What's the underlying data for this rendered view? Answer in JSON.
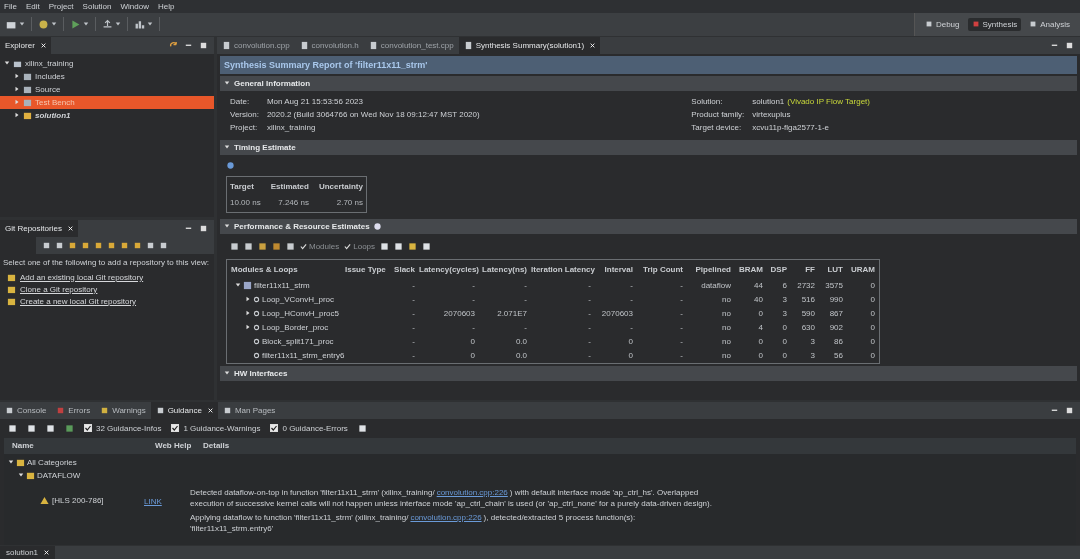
{
  "menu": [
    "File",
    "Edit",
    "Project",
    "Solution",
    "Window",
    "Help"
  ],
  "perspectives": [
    {
      "label": "Debug",
      "selected": false
    },
    {
      "label": "Synthesis",
      "selected": true
    },
    {
      "label": "Analysis",
      "selected": false
    }
  ],
  "explorer": {
    "title": "Explorer",
    "tree": [
      {
        "label": "xilinx_training",
        "expanded": true,
        "selected": false,
        "active": false,
        "children": [
          {
            "label": "Includes",
            "expanded": false,
            "selected": false,
            "active": false
          },
          {
            "label": "Source",
            "expanded": false,
            "selected": false,
            "active": false
          },
          {
            "label": "Test Bench",
            "expanded": false,
            "selected": true,
            "active": false
          },
          {
            "label": "solution1",
            "expanded": false,
            "selected": false,
            "active": true
          }
        ]
      }
    ]
  },
  "git": {
    "title": "Git Repositories",
    "intro": "Select one of the following to add a repository to this view:",
    "links": [
      "Add an existing local Git repository",
      "Clone a Git repository",
      "Create a new local Git repository"
    ]
  },
  "editor_tabs": [
    {
      "label": "convolution.cpp",
      "selected": false
    },
    {
      "label": "convolution.h",
      "selected": false
    },
    {
      "label": "convolution_test.cpp",
      "selected": false
    },
    {
      "label": "Synthesis Summary(solution1)",
      "selected": true
    }
  ],
  "report": {
    "title": "Synthesis Summary Report of 'filter11x11_strm'",
    "general": {
      "heading": "General Information",
      "left": [
        {
          "label": "Date:",
          "value": "Mon Aug 21 15:53:56 2023"
        },
        {
          "label": "Version:",
          "value": "2020.2 (Build 3064766 on Wed Nov 18 09:12:47 MST 2020)"
        },
        {
          "label": "Project:",
          "value": "xilinx_training"
        }
      ],
      "right": [
        {
          "label": "Solution:",
          "value": "solution1",
          "note": "(Vivado IP Flow Target)"
        },
        {
          "label": "Product family:",
          "value": "virtexuplus"
        },
        {
          "label": "Target device:",
          "value": "xcvu11p-flga2577-1-e"
        }
      ]
    },
    "timing": {
      "heading": "Timing Estimate",
      "columns": [
        "Target",
        "Estimated",
        "Uncertainty"
      ],
      "values": [
        "10.00 ns",
        "7.246 ns",
        "2.70 ns"
      ]
    },
    "perf": {
      "heading": "Performance & Resource Estimates",
      "filters": [
        {
          "label": "Modules",
          "checked": true
        },
        {
          "label": "Loops",
          "checked": true
        }
      ],
      "columns": [
        "Modules & Loops",
        "Issue Type",
        "Slack",
        "Latency(cycles)",
        "Latency(ns)",
        "Iteration Latency",
        "Interval",
        "Trip Count",
        "Pipelined",
        "BRAM",
        "DSP",
        "FF",
        "LUT",
        "URAM"
      ],
      "rows": [
        {
          "kind": "module",
          "expanded": true,
          "cells": [
            "filter11x11_strm",
            "",
            "-",
            "-",
            "-",
            "-",
            "-",
            "-",
            "dataflow",
            "44",
            "6",
            "2732",
            "3575",
            "0"
          ],
          "children": [
            {
              "kind": "group",
              "expanded": false,
              "cells": [
                "Loop_VConvH_proc",
                "",
                "-",
                "-",
                "-",
                "-",
                "-",
                "-",
                "no",
                "40",
                "3",
                "516",
                "990",
                "0"
              ]
            },
            {
              "kind": "group",
              "expanded": false,
              "cells": [
                "Loop_HConvH_proc5",
                "",
                "-",
                "2070603",
                "2.071E7",
                "-",
                "2070603",
                "-",
                "no",
                "0",
                "3",
                "590",
                "867",
                "0"
              ]
            },
            {
              "kind": "group",
              "expanded": false,
              "cells": [
                "Loop_Border_proc",
                "",
                "-",
                "-",
                "-",
                "-",
                "-",
                "-",
                "no",
                "4",
                "0",
                "630",
                "902",
                "0"
              ]
            },
            {
              "kind": "leaf",
              "cells": [
                "Block_split171_proc",
                "",
                "-",
                "0",
                "0.0",
                "-",
                "0",
                "-",
                "no",
                "0",
                "0",
                "3",
                "86",
                "0"
              ]
            },
            {
              "kind": "leaf",
              "cells": [
                "filter11x11_strm_entry6",
                "",
                "-",
                "0",
                "0.0",
                "-",
                "0",
                "-",
                "no",
                "0",
                "0",
                "3",
                "56",
                "0"
              ]
            }
          ]
        }
      ]
    },
    "hw": {
      "heading": "HW Interfaces"
    }
  },
  "bottom_tabs": [
    {
      "label": "Console",
      "selected": false
    },
    {
      "label": "Errors",
      "selected": false
    },
    {
      "label": "Warnings",
      "selected": false
    },
    {
      "label": "Guidance",
      "selected": true
    },
    {
      "label": "Man Pages",
      "selected": false
    }
  ],
  "guidance": {
    "filters": [
      {
        "label": "32 Guidance-Infos",
        "checked": true
      },
      {
        "label": "1 Guidance-Warnings",
        "checked": true
      },
      {
        "label": "0 Guidance-Errors",
        "checked": true
      }
    ],
    "columns": [
      "Name",
      "Web Help",
      "Details"
    ],
    "tree": [
      {
        "label": "All Categories",
        "expanded": true,
        "children": [
          {
            "label": "DATAFLOW",
            "expanded": true
          }
        ]
      }
    ],
    "message": {
      "id": "[HLS 200-786]",
      "web_help": "LINK",
      "details": [
        {
          "before": "Detected dataflow-on-top in function  'filter11x11_strm' (xilinx_training/",
          "link": "convolution.cpp:226",
          "after": ")  with default interface mode 'ap_ctrl_hs'. Overlapped execution of successive kernel calls will not happen unless interface mode 'ap_ctrl_chain' is used (or 'ap_ctrl_none' for a purely data-driven design)."
        },
        {
          "before": "Applying dataflow to function 'filter11x11_strm' (xilinx_training/",
          "link": "convolution.cpp:226",
          "after": "), detected/extracted 5 process function(s): 'filter11x11_strm.entry6'"
        }
      ]
    }
  },
  "status_tab": "solution1"
}
